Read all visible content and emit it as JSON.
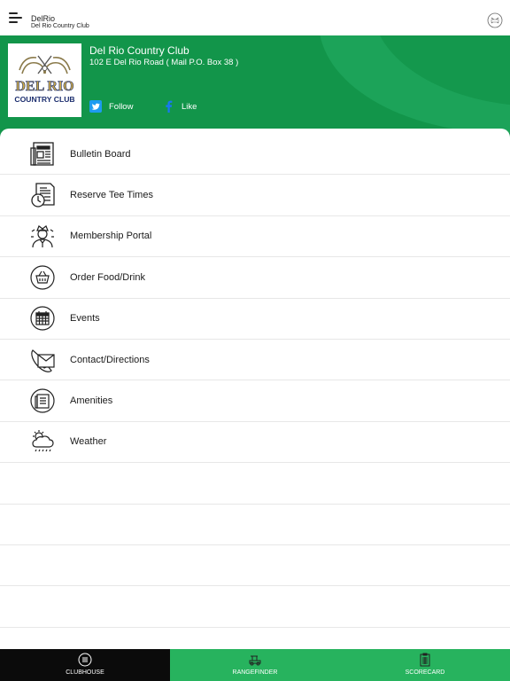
{
  "app": {
    "title": "DelRio",
    "subtitle": "Del Rio Country Club"
  },
  "club": {
    "name": "Del Rio Country Club",
    "address": "102 E Del Rio Road  ( Mail P.O. Box 38 )",
    "logo_text_top": "DEL RIO",
    "logo_text_bottom": "COUNTRY CLUB"
  },
  "social": {
    "twitter_label": "Follow",
    "facebook_label": "Like"
  },
  "menu": [
    {
      "label": "Bulletin Board",
      "icon": "newspaper-icon"
    },
    {
      "label": "Reserve Tee Times",
      "icon": "clock-document-icon"
    },
    {
      "label": "Membership Portal",
      "icon": "member-icon"
    },
    {
      "label": "Order Food/Drink",
      "icon": "basket-icon"
    },
    {
      "label": "Events",
      "icon": "calendar-icon"
    },
    {
      "label": "Contact/Directions",
      "icon": "phone-envelope-icon"
    },
    {
      "label": "Amenities",
      "icon": "list-icon"
    },
    {
      "label": "Weather",
      "icon": "weather-icon"
    }
  ],
  "tabs": [
    {
      "label": "CLUBHOUSE",
      "icon": "menu-circle-icon",
      "active": true
    },
    {
      "label": "RANGEFINDER",
      "icon": "golf-cart-icon",
      "active": false
    },
    {
      "label": "SCORECARD",
      "icon": "scorecard-icon",
      "active": false
    }
  ],
  "colors": {
    "brand_green": "#12954a",
    "tab_green": "#27b35e",
    "tab_active": "#0b0b0b",
    "twitter": "#1d9bf0"
  }
}
